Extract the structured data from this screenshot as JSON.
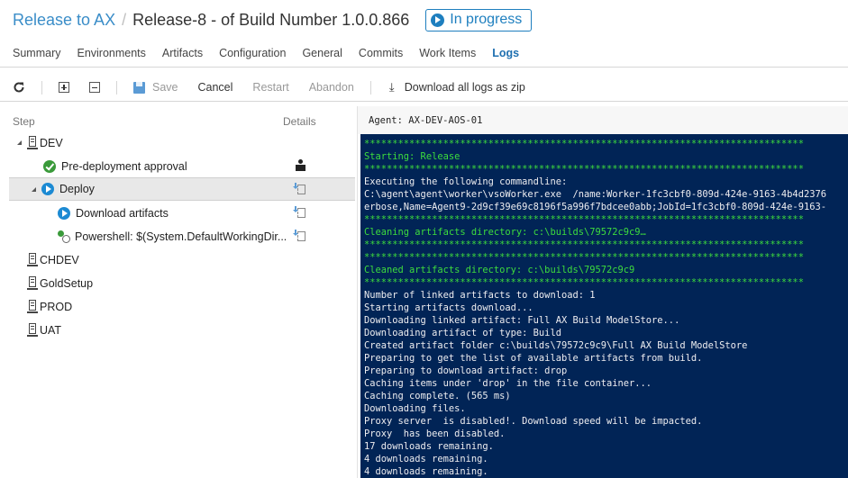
{
  "header": {
    "definition_link": "Release to AX",
    "separator": "/",
    "release_title": "Release-8 - of Build Number 1.0.0.866",
    "status": "In progress"
  },
  "tabs": [
    {
      "label": "Summary"
    },
    {
      "label": "Environments"
    },
    {
      "label": "Artifacts"
    },
    {
      "label": "Configuration"
    },
    {
      "label": "General"
    },
    {
      "label": "Commits"
    },
    {
      "label": "Work Items"
    },
    {
      "label": "Logs",
      "active": true
    }
  ],
  "toolbar": {
    "save": "Save",
    "cancel": "Cancel",
    "restart": "Restart",
    "abandon": "Abandon",
    "download": "Download all logs as zip"
  },
  "steps": {
    "col_step": "Step",
    "col_details": "Details",
    "environments": [
      {
        "name": "DEV",
        "expanded": true
      },
      {
        "name": "CHDEV"
      },
      {
        "name": "GoldSetup"
      },
      {
        "name": "PROD"
      },
      {
        "name": "UAT"
      }
    ],
    "dev_steps": [
      {
        "label": "Pre-deployment approval",
        "status": "succeeded",
        "detail_icon": "person-icon"
      },
      {
        "label": "Deploy",
        "status": "in-progress",
        "detail_icon": "log-icon",
        "selected": true
      },
      {
        "label": "Download artifacts",
        "status": "in-progress",
        "detail_icon": "log-icon"
      },
      {
        "label": "Powershell: $(System.DefaultWorkingDir...",
        "status": "pending",
        "detail_icon": "log-icon"
      }
    ]
  },
  "log": {
    "agent": "Agent: AX-DEV-AOS-01",
    "lines": [
      {
        "text": "******************************************************************************",
        "green": true
      },
      {
        "text": "Starting: Release",
        "green": true
      },
      {
        "text": "******************************************************************************",
        "green": true
      },
      {
        "text": "Executing the following commandline:"
      },
      {
        "text": "C:\\agent\\agent\\worker\\vsoWorker.exe  /name:Worker-1fc3cbf0-809d-424e-9163-4b4d2376"
      },
      {
        "text": "erbose,Name=Agent9-2d9cf39e69c8196f5a996f7bdcee0abb;JobId=1fc3cbf0-809d-424e-9163-"
      },
      {
        "text": "******************************************************************************",
        "green": true
      },
      {
        "text": "Cleaning artifacts directory: c:\\builds\\79572c9c9…",
        "green": true
      },
      {
        "text": "******************************************************************************",
        "green": true
      },
      {
        "text": "******************************************************************************",
        "green": true
      },
      {
        "text": "Cleaned artifacts directory: c:\\builds\\79572c9c9",
        "green": true
      },
      {
        "text": "******************************************************************************",
        "green": true
      },
      {
        "text": "Number of linked artifacts to download: 1"
      },
      {
        "text": "Starting artifacts download..."
      },
      {
        "text": "Downloading linked artifact: Full AX Build ModelStore..."
      },
      {
        "text": "Downloading artifact of type: Build"
      },
      {
        "text": "Created artifact folder c:\\builds\\79572c9c9\\Full AX Build ModelStore"
      },
      {
        "text": "Preparing to get the list of available artifacts from build."
      },
      {
        "text": "Preparing to download artifact: drop"
      },
      {
        "text": "Caching items under 'drop' in the file container..."
      },
      {
        "text": "Caching complete. (565 ms)"
      },
      {
        "text": "Downloading files."
      },
      {
        "text": "Proxy server  is disabled!. Download speed will be impacted."
      },
      {
        "text": "Proxy  has been disabled."
      },
      {
        "text": "17 downloads remaining."
      },
      {
        "text": "4 downloads remaining."
      },
      {
        "text": "4 downloads remaining."
      }
    ]
  },
  "colors": {
    "accent": "#1e7fbf",
    "link": "#3a8dc8",
    "log_bg": "#012456",
    "log_green": "#3ddc3d",
    "log_text": "#eeedf0",
    "success": "#3a9a3a"
  }
}
